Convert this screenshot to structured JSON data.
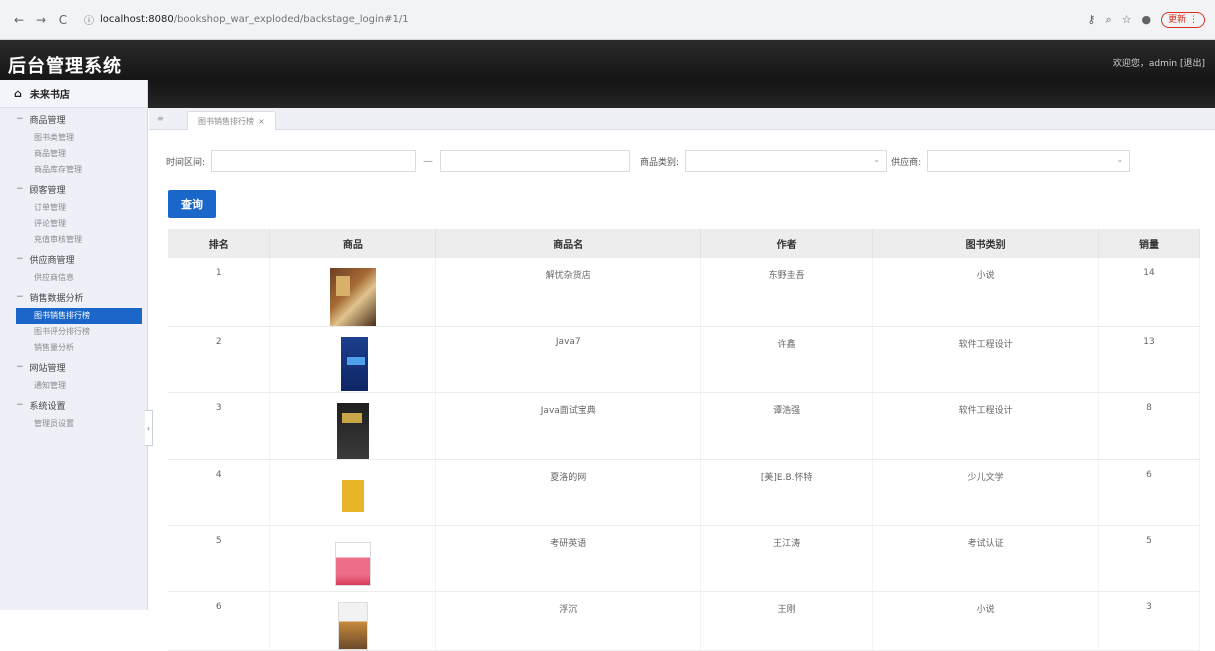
{
  "browser": {
    "back": "←",
    "forward": "→",
    "reload": "C",
    "host": "localhost:8080",
    "path": "/bookshop_war_exploded/backstage_login#1/1",
    "update_label": "更新"
  },
  "header": {
    "title": "后台管理系统",
    "welcome": "欢迎您，admin  [退出]"
  },
  "sidebar": {
    "store": "未来书店",
    "groups": [
      {
        "title": "商品管理",
        "items": [
          "图书类管理",
          "商品管理",
          "商品库存管理"
        ]
      },
      {
        "title": "顾客管理",
        "items": [
          "订单管理",
          "评论管理",
          "充值审核管理"
        ]
      },
      {
        "title": "供应商管理",
        "items": [
          "供应商信息"
        ]
      },
      {
        "title": "销售数据分析",
        "items": [
          "图书销售排行榜",
          "图书评分排行榜",
          "销售量分析"
        ]
      },
      {
        "title": "网站管理",
        "items": [
          "通知管理"
        ]
      },
      {
        "title": "系统设置",
        "items": [
          "管理员设置"
        ]
      }
    ]
  },
  "tab": {
    "label": "图书销售排行榜",
    "close": "×"
  },
  "filters": {
    "time_label": "时间区间:",
    "range_sep": "—",
    "category_label": "商品类别:",
    "supplier_label": "供应商:",
    "query_label": "查询"
  },
  "table": {
    "headers": [
      "排名",
      "商品",
      "商品名",
      "作者",
      "图书类别",
      "销量"
    ],
    "rows": [
      {
        "rank": "1",
        "name": "解忧杂货店",
        "author": "东野圭吾",
        "category": "小说",
        "sales": "14"
      },
      {
        "rank": "2",
        "name": "Java7",
        "author": "许鑫",
        "category": "软件工程设计",
        "sales": "13"
      },
      {
        "rank": "3",
        "name": "Java面试宝典",
        "author": "谭浩强",
        "category": "软件工程设计",
        "sales": "8"
      },
      {
        "rank": "4",
        "name": "夏洛的网",
        "author": "[美]E.B.怀特",
        "category": "少儿文学",
        "sales": "6"
      },
      {
        "rank": "5",
        "name": "考研英语",
        "author": "王江涛",
        "category": "考试认证",
        "sales": "5"
      },
      {
        "rank": "6",
        "name": "浮沉",
        "author": "王刚",
        "category": "小说",
        "sales": "3"
      }
    ]
  }
}
